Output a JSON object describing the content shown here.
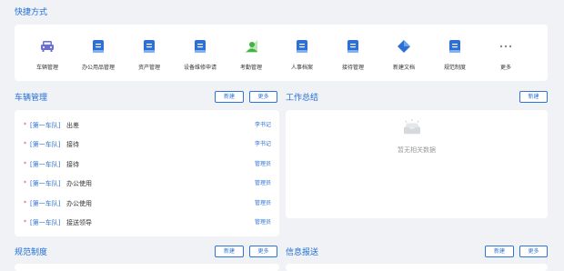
{
  "quick_access": {
    "title": "快捷方式",
    "items": [
      {
        "label": "车辆管理",
        "icon": "car-icon",
        "color": "#6a6fd6"
      },
      {
        "label": "办公用品管理",
        "icon": "document-icon",
        "color": "#2e6fd6"
      },
      {
        "label": "资产管理",
        "icon": "document-icon",
        "color": "#2e6fd6"
      },
      {
        "label": "设备维修申请",
        "icon": "document-icon",
        "color": "#2e6fd6"
      },
      {
        "label": "考勤管理",
        "icon": "person-icon",
        "color": "#3bb44a"
      },
      {
        "label": "人事档案",
        "icon": "document-icon",
        "color": "#2e6fd6"
      },
      {
        "label": "接待管理",
        "icon": "document-icon",
        "color": "#2e6fd6"
      },
      {
        "label": "新建文档",
        "icon": "diamond-icon",
        "color": "#2e6fd6"
      },
      {
        "label": "规范制度",
        "icon": "document-icon",
        "color": "#2e6fd6"
      },
      {
        "label": "更多",
        "icon": "more-icon",
        "color": "#888888"
      }
    ]
  },
  "vehicle": {
    "title": "车辆管理",
    "new_label": "新建",
    "more_label": "更多",
    "rows": [
      {
        "team": "[第一车队]",
        "title": "出差",
        "user": "李书记"
      },
      {
        "team": "[第一车队]",
        "title": "接待",
        "user": "李书记"
      },
      {
        "team": "[第一车队]",
        "title": "接待",
        "user": "管理员"
      },
      {
        "team": "[第一车队]",
        "title": "办公使用",
        "user": "管理员"
      },
      {
        "team": "[第一车队]",
        "title": "办公使用",
        "user": "管理员"
      },
      {
        "team": "[第一车队]",
        "title": "接送领导",
        "user": "管理员"
      }
    ]
  },
  "work_summary": {
    "title": "工作总结",
    "new_label": "新建",
    "empty_text": "暂无相关数据"
  },
  "regulations": {
    "title": "规范制度",
    "new_label": "新建",
    "more_label": "更多"
  },
  "info_report": {
    "title": "信息报送",
    "new_label": "新建",
    "more_label": "更多"
  },
  "colors": {
    "accent": "#2e73d9",
    "bullet": "#e0453a",
    "background": "#f0f2f5"
  }
}
